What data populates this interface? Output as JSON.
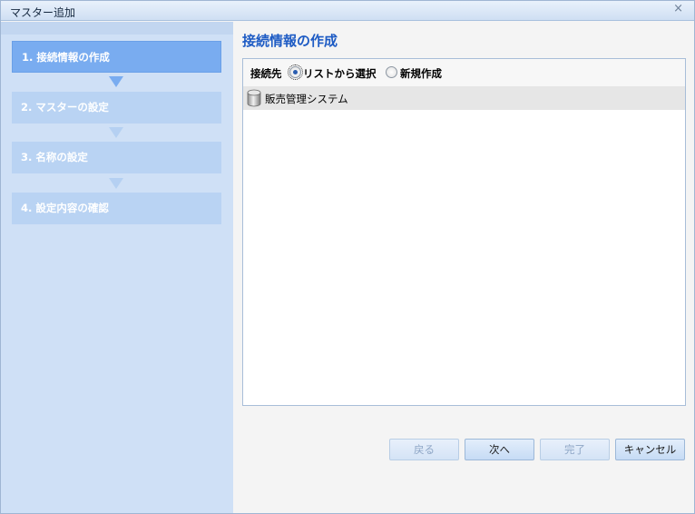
{
  "window": {
    "title": "マスター追加",
    "close_glyph": "×"
  },
  "steps": [
    {
      "label": "1. 接続情報の作成",
      "state": "active"
    },
    {
      "label": "2. マスターの設定",
      "state": "inactive"
    },
    {
      "label": "3. 名称の設定",
      "state": "inactive"
    },
    {
      "label": "4. 設定内容の確認",
      "state": "inactive"
    }
  ],
  "main": {
    "heading": "接続情報の作成",
    "connection": {
      "label": "接続先",
      "options": [
        {
          "label": "リストから選択",
          "selected": true
        },
        {
          "label": "新規作成",
          "selected": false
        }
      ]
    },
    "list": [
      {
        "label": "販売管理システム",
        "icon": "database-icon"
      }
    ]
  },
  "buttons": {
    "back": "戻る",
    "next": "次へ",
    "finish": "完了",
    "cancel": "キャンセル"
  },
  "colors": {
    "accent": "#1d5bc4",
    "step_active": "#79acf0",
    "step_inactive": "#b9d3f3",
    "sidebar": "#cfe0f6"
  }
}
